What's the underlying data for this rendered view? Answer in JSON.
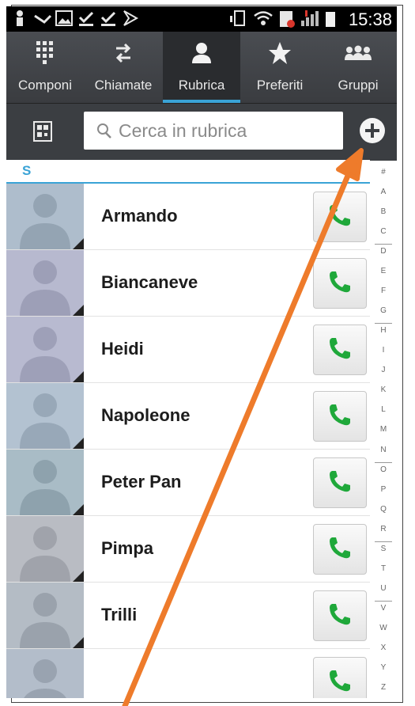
{
  "status_bar": {
    "time": "15:38",
    "icons": [
      "person-icon",
      "voicemail-icon",
      "picture-icon",
      "download-check-icon",
      "download-check-icon",
      "flag-icon",
      "vibrate-icon",
      "wifi-icon",
      "sim-icon",
      "signal-icon",
      "battery-icon"
    ]
  },
  "tabs": [
    {
      "label": "Componi",
      "icon": "dialpad-icon"
    },
    {
      "label": "Chiamate",
      "icon": "call-log-icon"
    },
    {
      "label": "Rubrica",
      "icon": "contacts-icon",
      "active": true
    },
    {
      "label": "Preferiti",
      "icon": "star-icon"
    },
    {
      "label": "Gruppi",
      "icon": "groups-icon"
    }
  ],
  "search": {
    "placeholder": "Cerca in rubrica",
    "left_icon": "qr-scan-icon",
    "add_icon": "add-contact-icon"
  },
  "section_letter": "S",
  "contacts": [
    {
      "name": "Armando",
      "avatar_bg": "#aebdcc"
    },
    {
      "name": "Biancaneve",
      "avatar_bg": "#b7b9cf"
    },
    {
      "name": "Heidi",
      "avatar_bg": "#b8bad0"
    },
    {
      "name": "Napoleone",
      "avatar_bg": "#b3c2d1"
    },
    {
      "name": "Peter Pan",
      "avatar_bg": "#a9bcc6"
    },
    {
      "name": "Pimpa",
      "avatar_bg": "#b9bcc3"
    },
    {
      "name": "Trilli",
      "avatar_bg": "#b4bcc5"
    },
    {
      "name": "",
      "avatar_bg": "#b3bdca"
    }
  ],
  "index": [
    "#",
    "A",
    "B",
    "C",
    "D",
    "E",
    "F",
    "G",
    "H",
    "I",
    "J",
    "K",
    "L",
    "M",
    "N",
    "O",
    "P",
    "Q",
    "R",
    "S",
    "T",
    "U",
    "V",
    "W",
    "X",
    "Y",
    "Z"
  ],
  "colors": {
    "accent": "#3aa3d6",
    "call_green": "#1fa83a",
    "arrow": "#ee7b2b"
  }
}
